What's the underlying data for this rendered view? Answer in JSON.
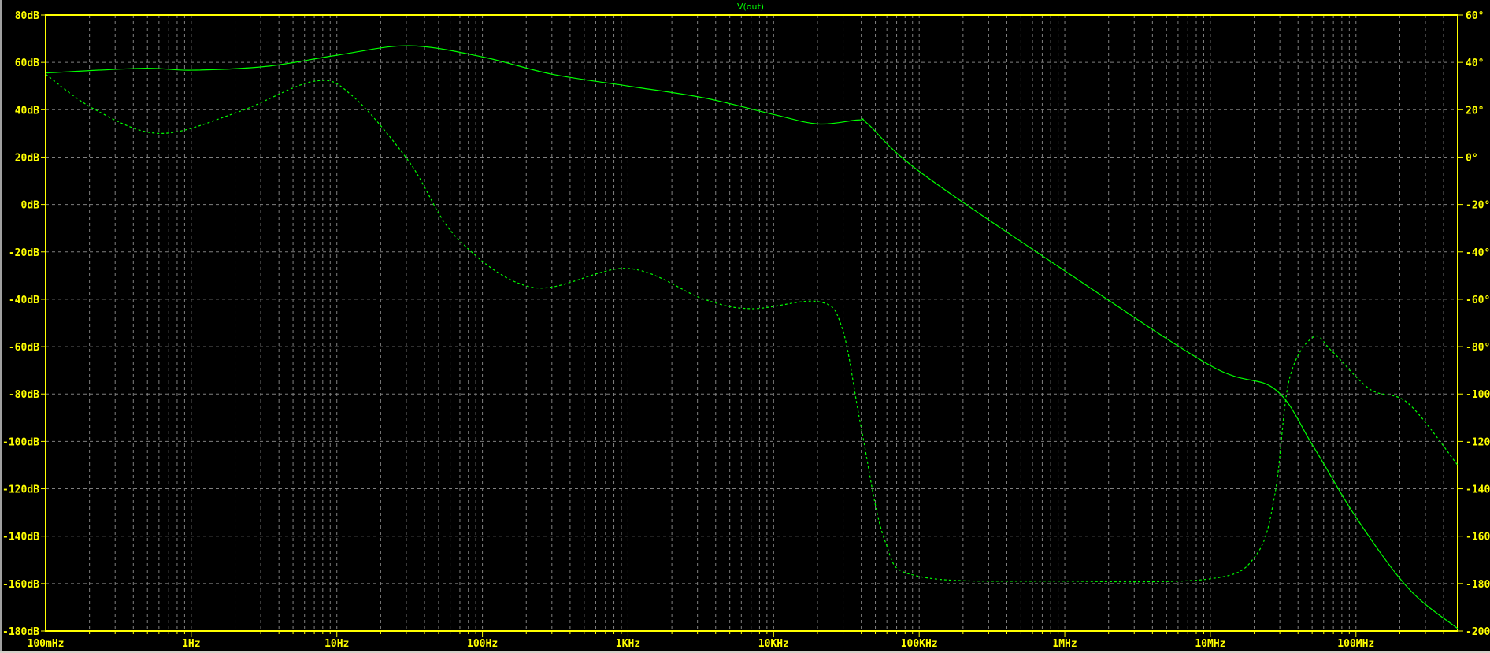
{
  "chart_data": {
    "type": "line",
    "title": "V(out)",
    "x_scale": "log",
    "xlim": [
      0.1,
      500000000
    ],
    "x_ticks": [
      {
        "value": 0.1,
        "label": "100mHz"
      },
      {
        "value": 1,
        "label": "1Hz"
      },
      {
        "value": 10,
        "label": "10Hz"
      },
      {
        "value": 100,
        "label": "100Hz"
      },
      {
        "value": 1000,
        "label": "1KHz"
      },
      {
        "value": 10000,
        "label": "10KHz"
      },
      {
        "value": 100000,
        "label": "100KHz"
      },
      {
        "value": 1000000,
        "label": "1MHz"
      },
      {
        "value": 10000000,
        "label": "10MHz"
      },
      {
        "value": 100000000,
        "label": "100MHz"
      }
    ],
    "y_left": {
      "unit": "dB",
      "ylim": [
        -180,
        80
      ],
      "ticks": [
        "80dB",
        "60dB",
        "40dB",
        "20dB",
        "0dB",
        "-20dB",
        "-40dB",
        "-60dB",
        "-80dB",
        "-100dB",
        "-120dB",
        "-140dB",
        "-160dB",
        "-180dB"
      ]
    },
    "y_right": {
      "unit": "°",
      "ylim": [
        -200,
        60
      ],
      "ticks": [
        "60°",
        "40°",
        "20°",
        "0°",
        "-20°",
        "-40°",
        "-60°",
        "-80°",
        "-100°",
        "-120°",
        "-140°",
        "-160°",
        "-180°",
        "-200°"
      ]
    },
    "grid": true,
    "series": [
      {
        "axis": "left",
        "style": "solid",
        "x": [
          0.1,
          0.464,
          1,
          3.28,
          10,
          31.4,
          100,
          300,
          1000,
          3330,
          10000,
          20300,
          38700,
          44400,
          100000,
          1000000,
          10000000,
          27800000,
          50800000,
          100000000,
          229000000,
          500000000
        ],
        "y": [
          55.5,
          57.5,
          56.7,
          58.3,
          63,
          67,
          62.3,
          55,
          50,
          45,
          38,
          34,
          35.7,
          34,
          14,
          -28,
          -68,
          -78,
          -102,
          -132,
          -162,
          -179
        ]
      },
      {
        "axis": "right",
        "style": "dashed",
        "x": [
          0.1,
          0.219,
          0.61,
          2.09,
          6.97,
          12.7,
          31.4,
          66.6,
          222,
          1000,
          3330,
          7080,
          20300,
          29500,
          39900,
          58200,
          100000,
          1000000,
          10000000,
          20600000,
          27800000,
          34800000,
          50800000,
          68700000,
          125000000,
          229000000,
          500000000
        ],
        "y": [
          35,
          20,
          10,
          19,
          32,
          26,
          -2,
          -34,
          -55,
          -47,
          -60,
          -64,
          -61,
          -72,
          -114,
          -162,
          -177,
          -179,
          -178,
          -168,
          -142,
          -94,
          -76,
          -82,
          -98,
          -104,
          -130
        ]
      }
    ],
    "colors": {
      "background": "#000000",
      "axis": "#ffff00",
      "grid": "#808080",
      "trace": "#00ff00"
    }
  }
}
